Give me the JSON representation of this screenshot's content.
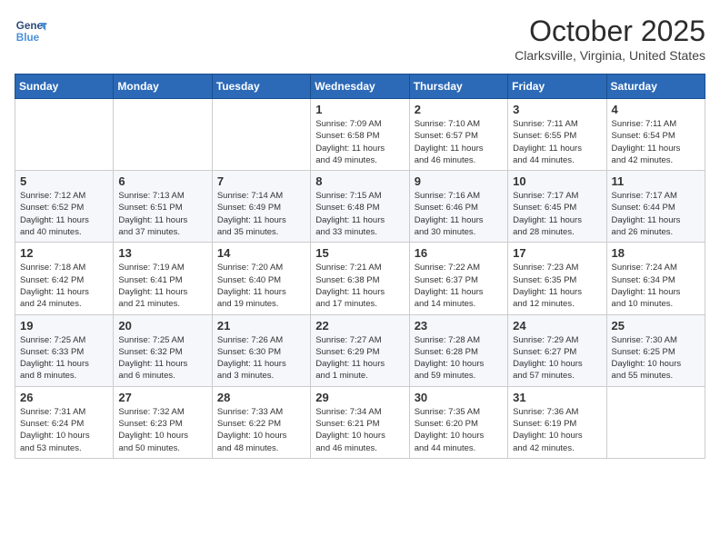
{
  "logo": {
    "line1": "General",
    "line2": "Blue"
  },
  "header": {
    "month": "October 2025",
    "location": "Clarksville, Virginia, United States"
  },
  "weekdays": [
    "Sunday",
    "Monday",
    "Tuesday",
    "Wednesday",
    "Thursday",
    "Friday",
    "Saturday"
  ],
  "weeks": [
    [
      {
        "day": "",
        "info": ""
      },
      {
        "day": "",
        "info": ""
      },
      {
        "day": "",
        "info": ""
      },
      {
        "day": "1",
        "info": "Sunrise: 7:09 AM\nSunset: 6:58 PM\nDaylight: 11 hours\nand 49 minutes."
      },
      {
        "day": "2",
        "info": "Sunrise: 7:10 AM\nSunset: 6:57 PM\nDaylight: 11 hours\nand 46 minutes."
      },
      {
        "day": "3",
        "info": "Sunrise: 7:11 AM\nSunset: 6:55 PM\nDaylight: 11 hours\nand 44 minutes."
      },
      {
        "day": "4",
        "info": "Sunrise: 7:11 AM\nSunset: 6:54 PM\nDaylight: 11 hours\nand 42 minutes."
      }
    ],
    [
      {
        "day": "5",
        "info": "Sunrise: 7:12 AM\nSunset: 6:52 PM\nDaylight: 11 hours\nand 40 minutes."
      },
      {
        "day": "6",
        "info": "Sunrise: 7:13 AM\nSunset: 6:51 PM\nDaylight: 11 hours\nand 37 minutes."
      },
      {
        "day": "7",
        "info": "Sunrise: 7:14 AM\nSunset: 6:49 PM\nDaylight: 11 hours\nand 35 minutes."
      },
      {
        "day": "8",
        "info": "Sunrise: 7:15 AM\nSunset: 6:48 PM\nDaylight: 11 hours\nand 33 minutes."
      },
      {
        "day": "9",
        "info": "Sunrise: 7:16 AM\nSunset: 6:46 PM\nDaylight: 11 hours\nand 30 minutes."
      },
      {
        "day": "10",
        "info": "Sunrise: 7:17 AM\nSunset: 6:45 PM\nDaylight: 11 hours\nand 28 minutes."
      },
      {
        "day": "11",
        "info": "Sunrise: 7:17 AM\nSunset: 6:44 PM\nDaylight: 11 hours\nand 26 minutes."
      }
    ],
    [
      {
        "day": "12",
        "info": "Sunrise: 7:18 AM\nSunset: 6:42 PM\nDaylight: 11 hours\nand 24 minutes."
      },
      {
        "day": "13",
        "info": "Sunrise: 7:19 AM\nSunset: 6:41 PM\nDaylight: 11 hours\nand 21 minutes."
      },
      {
        "day": "14",
        "info": "Sunrise: 7:20 AM\nSunset: 6:40 PM\nDaylight: 11 hours\nand 19 minutes."
      },
      {
        "day": "15",
        "info": "Sunrise: 7:21 AM\nSunset: 6:38 PM\nDaylight: 11 hours\nand 17 minutes."
      },
      {
        "day": "16",
        "info": "Sunrise: 7:22 AM\nSunset: 6:37 PM\nDaylight: 11 hours\nand 14 minutes."
      },
      {
        "day": "17",
        "info": "Sunrise: 7:23 AM\nSunset: 6:35 PM\nDaylight: 11 hours\nand 12 minutes."
      },
      {
        "day": "18",
        "info": "Sunrise: 7:24 AM\nSunset: 6:34 PM\nDaylight: 11 hours\nand 10 minutes."
      }
    ],
    [
      {
        "day": "19",
        "info": "Sunrise: 7:25 AM\nSunset: 6:33 PM\nDaylight: 11 hours\nand 8 minutes."
      },
      {
        "day": "20",
        "info": "Sunrise: 7:25 AM\nSunset: 6:32 PM\nDaylight: 11 hours\nand 6 minutes."
      },
      {
        "day": "21",
        "info": "Sunrise: 7:26 AM\nSunset: 6:30 PM\nDaylight: 11 hours\nand 3 minutes."
      },
      {
        "day": "22",
        "info": "Sunrise: 7:27 AM\nSunset: 6:29 PM\nDaylight: 11 hours\nand 1 minute."
      },
      {
        "day": "23",
        "info": "Sunrise: 7:28 AM\nSunset: 6:28 PM\nDaylight: 10 hours\nand 59 minutes."
      },
      {
        "day": "24",
        "info": "Sunrise: 7:29 AM\nSunset: 6:27 PM\nDaylight: 10 hours\nand 57 minutes."
      },
      {
        "day": "25",
        "info": "Sunrise: 7:30 AM\nSunset: 6:25 PM\nDaylight: 10 hours\nand 55 minutes."
      }
    ],
    [
      {
        "day": "26",
        "info": "Sunrise: 7:31 AM\nSunset: 6:24 PM\nDaylight: 10 hours\nand 53 minutes."
      },
      {
        "day": "27",
        "info": "Sunrise: 7:32 AM\nSunset: 6:23 PM\nDaylight: 10 hours\nand 50 minutes."
      },
      {
        "day": "28",
        "info": "Sunrise: 7:33 AM\nSunset: 6:22 PM\nDaylight: 10 hours\nand 48 minutes."
      },
      {
        "day": "29",
        "info": "Sunrise: 7:34 AM\nSunset: 6:21 PM\nDaylight: 10 hours\nand 46 minutes."
      },
      {
        "day": "30",
        "info": "Sunrise: 7:35 AM\nSunset: 6:20 PM\nDaylight: 10 hours\nand 44 minutes."
      },
      {
        "day": "31",
        "info": "Sunrise: 7:36 AM\nSunset: 6:19 PM\nDaylight: 10 hours\nand 42 minutes."
      },
      {
        "day": "",
        "info": ""
      }
    ]
  ]
}
